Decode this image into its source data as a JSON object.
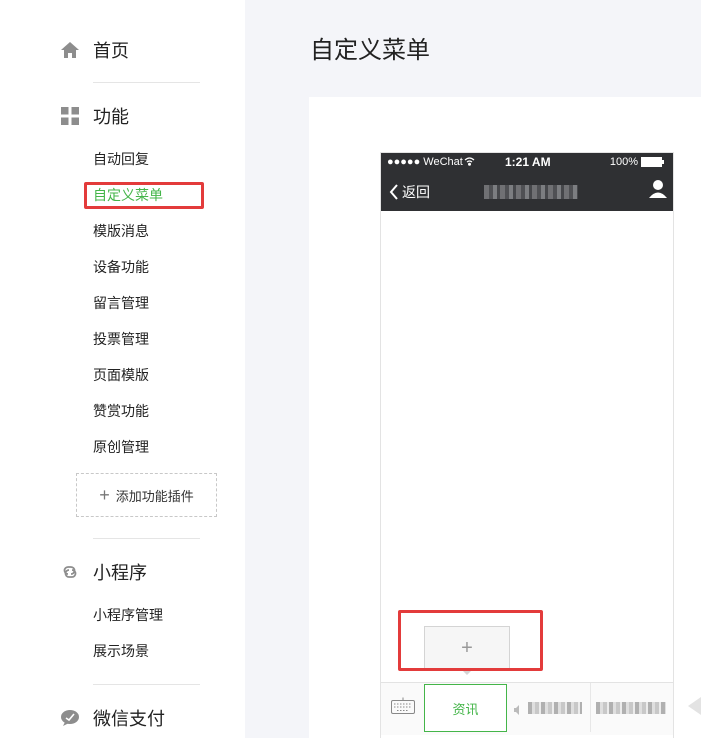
{
  "sidebar": {
    "home": {
      "label": "首页",
      "icon": "home-icon"
    },
    "features": {
      "label": "功能",
      "icon": "grid-icon",
      "items": [
        "自动回复",
        "自定义菜单",
        "模版消息",
        "设备功能",
        "留言管理",
        "投票管理",
        "页面模版",
        "赞赏功能",
        "原创管理"
      ],
      "active_index": 1,
      "add_plugin": "添加功能插件"
    },
    "mini_program": {
      "label": "小程序",
      "icon": "link-icon",
      "items": [
        "小程序管理",
        "展示场景"
      ]
    },
    "wechat_pay": {
      "label": "微信支付",
      "icon": "chat-bubble-icon"
    }
  },
  "main": {
    "title": "自定义菜单"
  },
  "phone": {
    "status": {
      "carrier": "●●●●● WeChat",
      "time": "1:21 AM",
      "battery": "100%"
    },
    "nav": {
      "back_label": "返回"
    },
    "menu": {
      "first_item": "资讯",
      "add_sub_label": "+"
    }
  },
  "colors": {
    "accent_green": "#44b549",
    "highlight_red": "#e33b3b",
    "phone_header": "#2f3033"
  }
}
